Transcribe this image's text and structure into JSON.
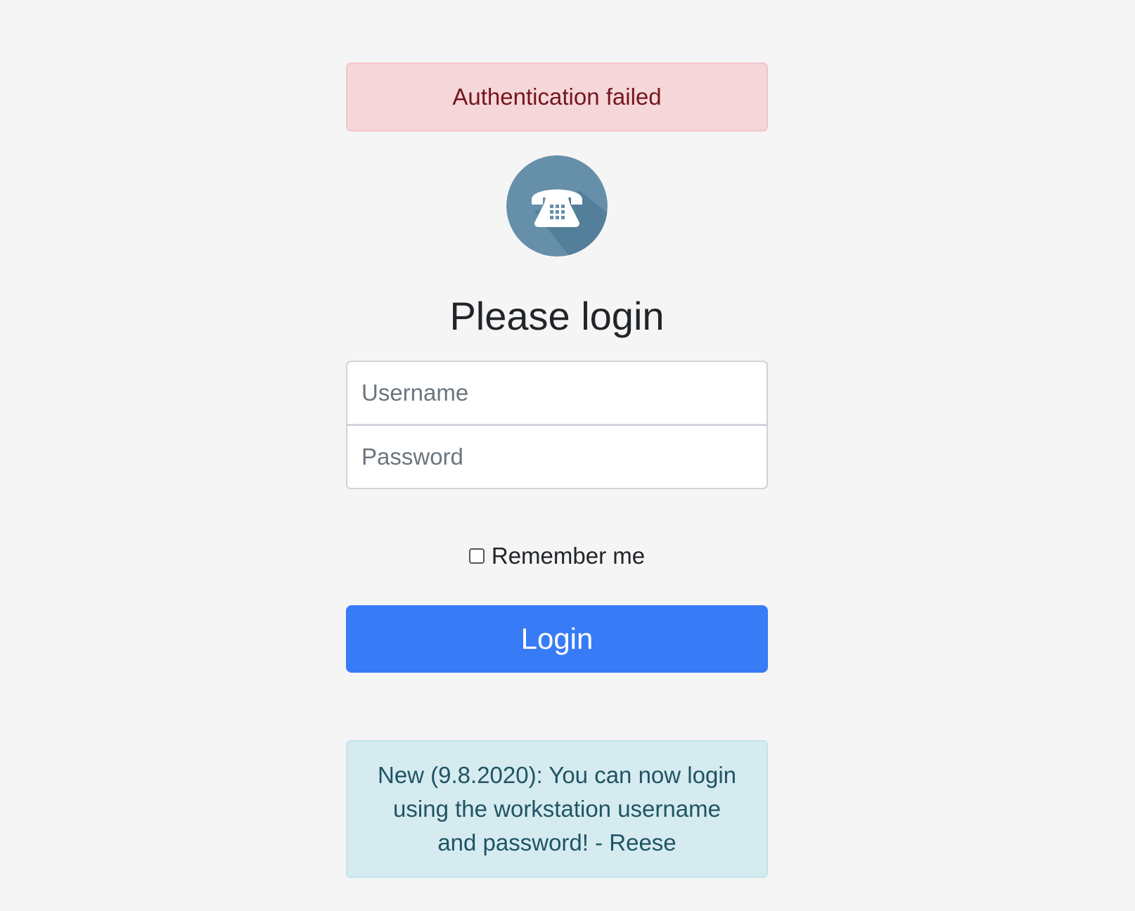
{
  "alert": {
    "text": "Authentication failed",
    "color": "#74161d",
    "background": "#f5d7da"
  },
  "logo": {
    "icon": "telephone-icon",
    "background": "#6690aa"
  },
  "heading": "Please login",
  "form": {
    "username_placeholder": "Username",
    "password_placeholder": "Password",
    "remember_label": "Remember me",
    "remember_checked": false,
    "login_label": "Login",
    "login_color": "#377bf7"
  },
  "notice": {
    "text": "New (9.8.2020): You can now login using the workstation username and password! - Reese",
    "color": "#1f5463",
    "background": "#d5ebf0"
  }
}
